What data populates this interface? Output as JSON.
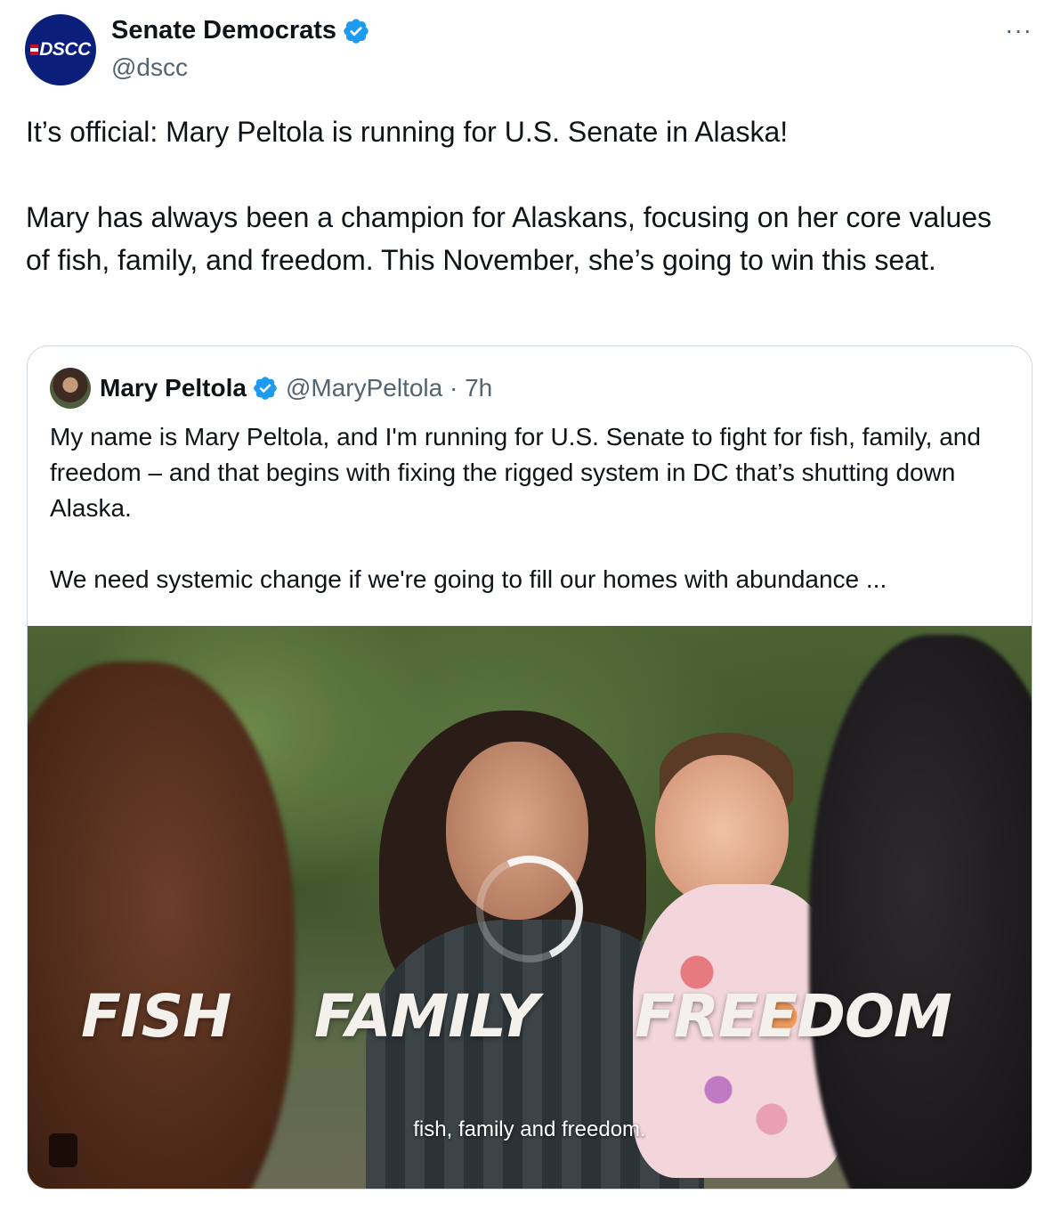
{
  "author": {
    "display_name": "Senate Democrats",
    "handle": "@dscc",
    "avatar_text": "DSCC",
    "verified_icon": "verified-badge-icon"
  },
  "more_label": "···",
  "tweet_text": "It’s official: Mary Peltola is running for U.S. Senate in Alaska!\n\nMary has always been a champion for Alaskans, focusing on her core values of fish, family, and freedom. This November, she’s going to win this seat.",
  "quote": {
    "display_name": "Mary Peltola",
    "handle_time": "@MaryPeltola · 7h",
    "text": "My name is Mary Peltola, and I'm running for U.S. Senate to fight for fish, family, and freedom – and that begins with fixing the rigged system in DC that’s shutting down Alaska.\n\nWe need systemic change if we're going to fill our homes with abundance ...",
    "video": {
      "overlay_words": [
        "FISH",
        "FAMILY",
        "FREEDOM"
      ],
      "caption": "fish, family and freedom."
    }
  },
  "colors": {
    "text_primary": "#0f1419",
    "text_secondary": "#536471",
    "verified_blue": "#1d9bf0",
    "border": "#cfd9de",
    "dscc_navy": "#0b1f7a"
  }
}
